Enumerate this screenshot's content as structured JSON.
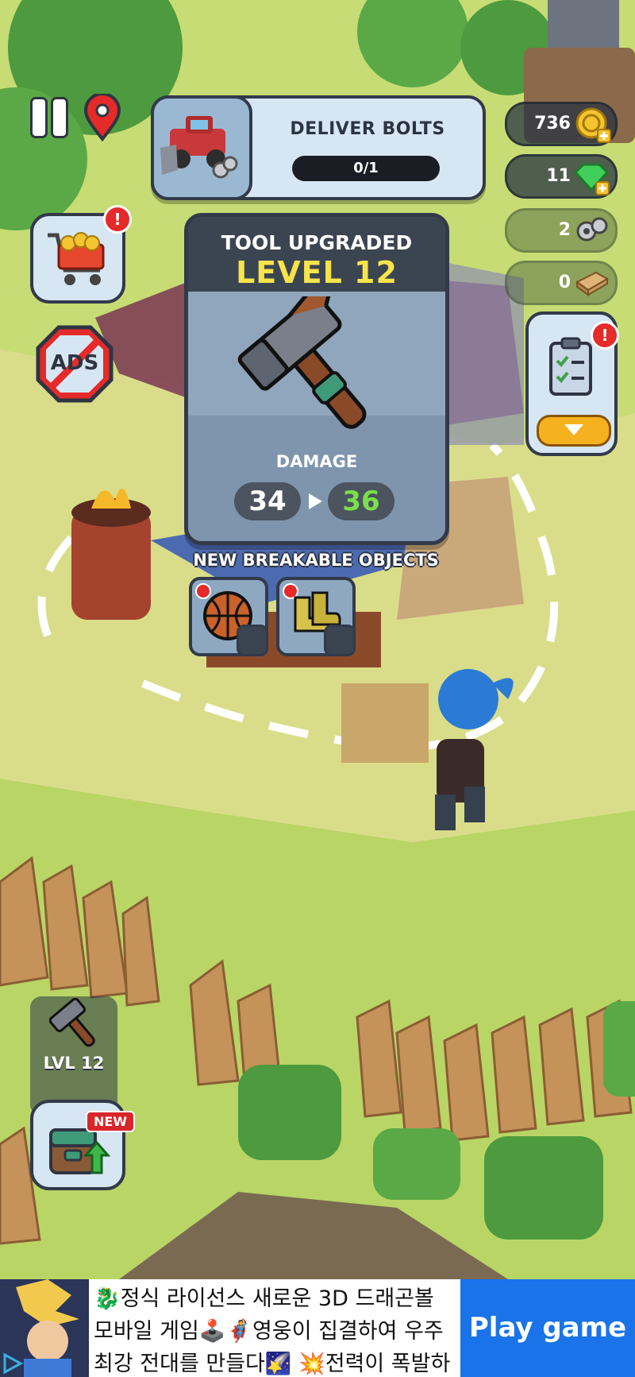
{
  "quest": {
    "title": "DELIVER BOLTS",
    "progress": "0/1",
    "progress_fraction": 0.0
  },
  "currencies": [
    {
      "name": "coins",
      "value": "736",
      "icon": "coin-icon"
    },
    {
      "name": "gems",
      "value": "11",
      "icon": "gem-icon"
    },
    {
      "name": "bolts",
      "value": "2",
      "icon": "bolt-icon"
    },
    {
      "name": "planks",
      "value": "0",
      "icon": "plank-icon"
    }
  ],
  "buttons": {
    "ads_label": "ADS"
  },
  "popup": {
    "title": "TOOL UPGRADED",
    "level": "LEVEL 12",
    "stat_label": "DAMAGE",
    "stat_old": "34",
    "stat_new": "36",
    "new_objects_title": "NEW BREAKABLE OBJECTS",
    "objects": [
      {
        "icon": "basketball-icon"
      },
      {
        "icon": "boots-icon"
      }
    ]
  },
  "tool": {
    "level_label": "LVL 12"
  },
  "inventory": {
    "new_label": "NEW"
  },
  "colors": {
    "level_yellow": "#f7e44a",
    "new_value_green": "#7be04a",
    "badge_red": "#e52a2a",
    "cta_blue": "#1a73e8"
  },
  "ad": {
    "text": "🐉정식 라이선스 새로운 3D 드래곤볼 모바일 게임🕹️🦸영웅이 집결하여 우주 최강 전대를 만들다🌠 💥전력이 폭발하여, 초연하",
    "cta": "Play game"
  }
}
